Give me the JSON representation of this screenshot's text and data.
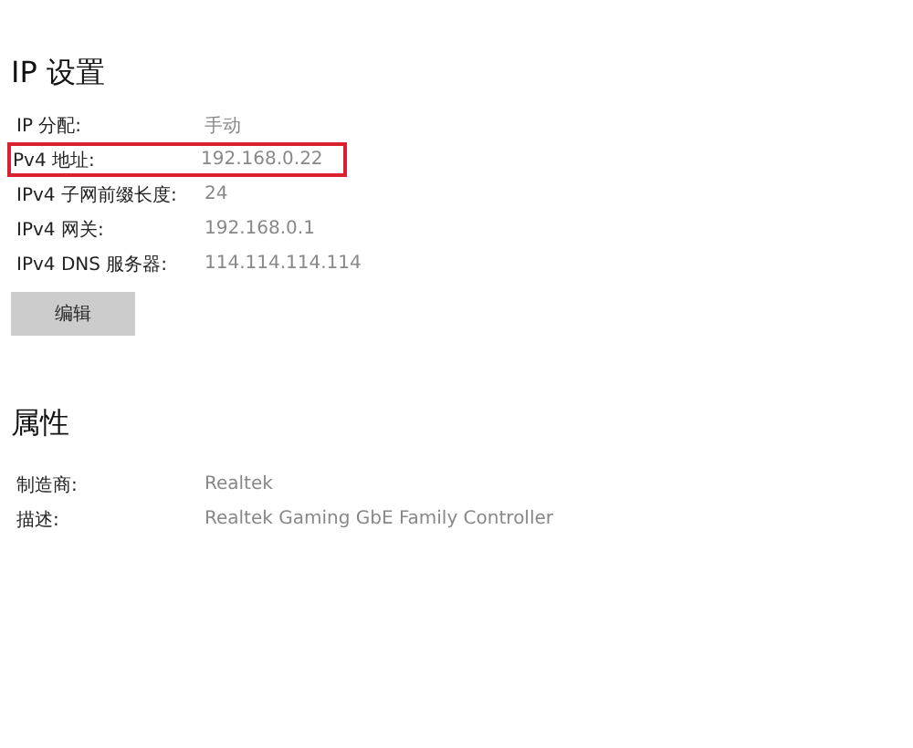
{
  "ip_settings": {
    "title": "IP 设置",
    "rows": [
      {
        "label": "IP 分配:",
        "value": "手动",
        "highlighted": false
      },
      {
        "label": "Pv4 地址:",
        "value": "192.168.0.22",
        "highlighted": true
      },
      {
        "label": "IPv4 子网前缀长度:",
        "value": "24",
        "highlighted": false
      },
      {
        "label": "IPv4 网关:",
        "value": "192.168.0.1",
        "highlighted": false
      },
      {
        "label": "IPv4 DNS 服务器:",
        "value": "114.114.114.114",
        "highlighted": false
      }
    ],
    "edit_button": "编辑"
  },
  "properties": {
    "title": "属性",
    "rows": [
      {
        "label": "制造商:",
        "value": "Realtek"
      },
      {
        "label": "描述:",
        "value": "Realtek Gaming GbE Family Controller"
      }
    ]
  }
}
